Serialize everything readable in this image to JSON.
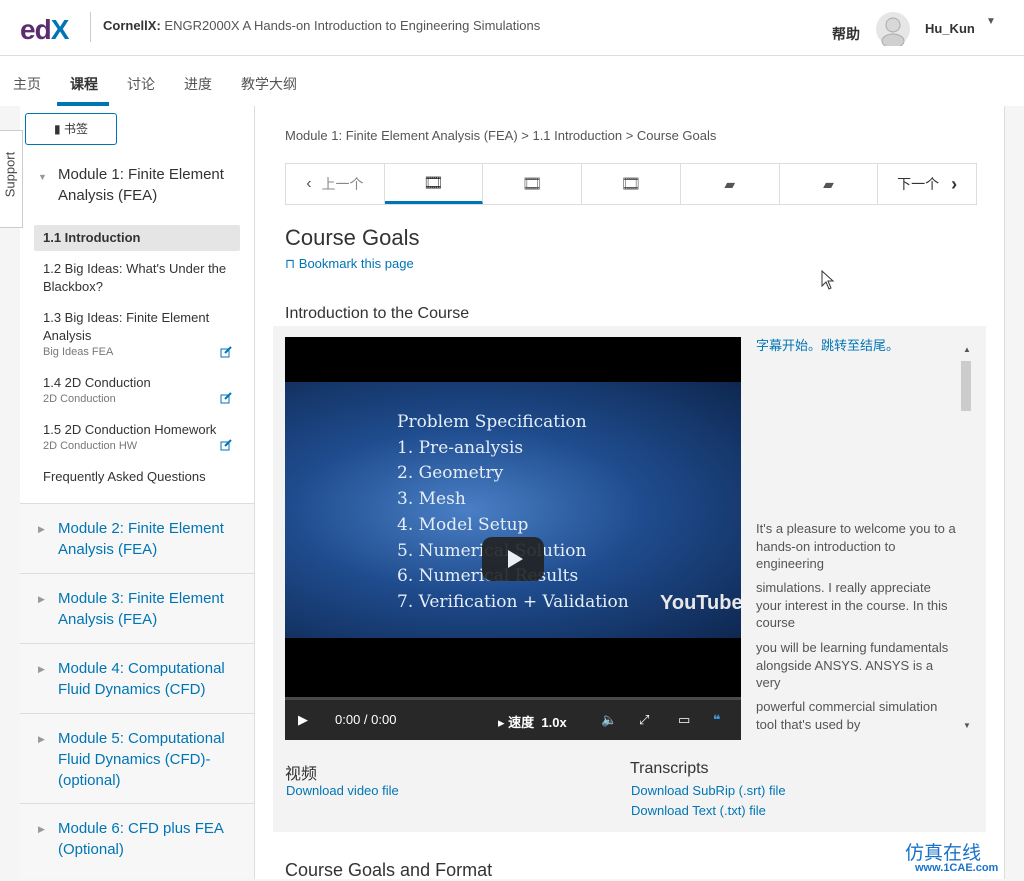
{
  "header": {
    "logo": "edX",
    "course_org": "CornellX:",
    "course_title": "ENGR2000X A Hands-on Introduction to Engineering Simulations",
    "help": "帮助",
    "username": "Hu_Kun"
  },
  "tabs": [
    {
      "label": "主页"
    },
    {
      "label": "课程"
    },
    {
      "label": "讨论"
    },
    {
      "label": "进度"
    },
    {
      "label": "教学大纲"
    }
  ],
  "support_label": "Support",
  "sidebar": {
    "bookmarks_label": "书签",
    "module1": "Module 1: Finite Element Analysis (FEA)",
    "items": [
      {
        "label": "1.1 Introduction",
        "sub": ""
      },
      {
        "label": "1.2 Big Ideas: What's Under the Blackbox?",
        "sub": ""
      },
      {
        "label": "1.3 Big Ideas: Finite Element Analysis",
        "sub": "Big Ideas FEA"
      },
      {
        "label": "1.4 2D Conduction",
        "sub": "2D Conduction"
      },
      {
        "label": "1.5 2D Conduction Homework",
        "sub": "2D Conduction HW"
      },
      {
        "label": "Frequently Asked Questions",
        "sub": ""
      }
    ],
    "modules": [
      {
        "label": "Module 2: Finite Element Analysis (FEA)"
      },
      {
        "label": "Module 3: Finite Element Analysis (FEA)"
      },
      {
        "label": "Module 4: Computational Fluid Dynamics (CFD)"
      },
      {
        "label": "Module 5: Computational Fluid Dynamics (CFD)-(optional)"
      },
      {
        "label": "Module 6: CFD plus FEA (Optional)"
      }
    ]
  },
  "main": {
    "breadcrumb": "Module 1: Finite Element Analysis (FEA) > 1.1 Introduction > Course Goals",
    "seq_prev": "上一个",
    "seq_next": "下一个",
    "unit_title": "Course Goals",
    "bookmark_link": "Bookmark this page",
    "intro_title": "Introduction to the Course",
    "slide": {
      "title": "Problem Specification",
      "lines": [
        "1. Pre-analysis",
        "2. Geometry",
        "3. Mesh",
        "4. Model Setup",
        "5. Numerical Solution",
        "6. Numerical Results",
        "7. Verification + Validation"
      ],
      "yt": "YouTube"
    },
    "player": {
      "time": "0:00 / 0:00",
      "speed_label": "速度",
      "speed": "1.0x"
    },
    "transcript": [
      "字幕开始。跳转至结尾。",
      "It's a pleasure to welcome you to a hands-on introduction to engineering",
      "simulations. I really appreciate your interest in the course. In this course",
      "you will be learning fundamentals alongside ANSYS. ANSYS is a very",
      "powerful commercial simulation tool that's used by"
    ],
    "video_head": "视频",
    "video_link": "Download video file",
    "transcripts_head": "Transcripts",
    "srt_link": "Download SubRip (.srt) file",
    "txt_link": "Download Text (.txt) file",
    "section2": "Course Goals and Format"
  },
  "watermark": "仿真在线",
  "watermark_url": "www.1CAE.com"
}
